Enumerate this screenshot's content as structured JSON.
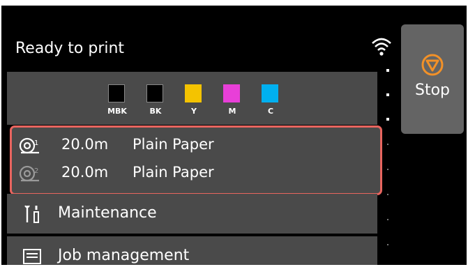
{
  "status": {
    "text": "Ready to print"
  },
  "icons": {
    "wifi": "wifi-icon",
    "stop": "stop-icon",
    "roll1": "roll-1-icon",
    "roll2": "roll-2-icon",
    "maintenance": "maintenance-icon",
    "job": "job-management-icon"
  },
  "stop_button": {
    "label": "Stop",
    "accent_color": "#f29128"
  },
  "ink": [
    {
      "label": "MBK",
      "color": "#000000"
    },
    {
      "label": "BK",
      "color": "#000000"
    },
    {
      "label": "Y",
      "color": "#f4c300"
    },
    {
      "label": "M",
      "color": "#e83fd8"
    },
    {
      "label": "C",
      "color": "#00b0f0"
    }
  ],
  "paper": {
    "highlight_color": "#e8655f",
    "rolls": [
      {
        "length": "20.0m",
        "type": "Plain Paper"
      },
      {
        "length": "20.0m",
        "type": "Plain Paper"
      }
    ]
  },
  "menu": {
    "maintenance": "Maintenance",
    "job_management": "Job management"
  }
}
